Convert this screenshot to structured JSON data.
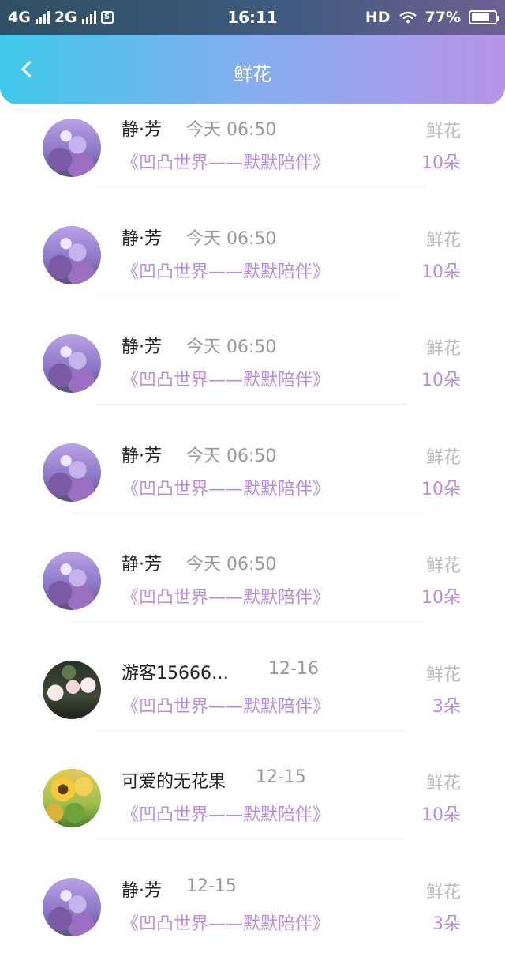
{
  "status_bar": {
    "network1": "4G",
    "network2": "2G",
    "sim_badge": "S",
    "time": "16:11",
    "hd": "HD",
    "battery_text": "77%",
    "battery_level": 0.77
  },
  "header": {
    "title": "鲜花"
  },
  "gift_label": "鲜花",
  "items": [
    {
      "name": "静·芳",
      "time": "今天 06:50",
      "work": "《凹凸世界——默默陪伴》",
      "count": "10朵",
      "avatar": "lavender-avatar"
    },
    {
      "name": "静·芳",
      "time": "今天 06:50",
      "work": "《凹凸世界——默默陪伴》",
      "count": "10朵",
      "avatar": "lavender-avatar"
    },
    {
      "name": "静·芳",
      "time": "今天 06:50",
      "work": "《凹凸世界——默默陪伴》",
      "count": "10朵",
      "avatar": "lavender-avatar"
    },
    {
      "name": "静·芳",
      "time": "今天 06:50",
      "work": "《凹凸世界——默默陪伴》",
      "count": "10朵",
      "avatar": "lavender-avatar"
    },
    {
      "name": "静·芳",
      "time": "今天 06:50",
      "work": "《凹凸世界——默默陪伴》",
      "count": "10朵",
      "avatar": "lavender-avatar"
    },
    {
      "name": "游客15666…",
      "time": "12-16",
      "work": "《凹凸世界——默默陪伴》",
      "count": "3朵",
      "avatar": "roses-avatar"
    },
    {
      "name": "可爱的无花果",
      "time": "12-15",
      "work": "《凹凸世界——默默陪伴》",
      "count": "10朵",
      "avatar": "sunflower-avatar"
    },
    {
      "name": "静·芳",
      "time": "12-15",
      "work": "《凹凸世界——默默陪伴》",
      "count": "3朵",
      "avatar": "lavender-avatar"
    }
  ]
}
